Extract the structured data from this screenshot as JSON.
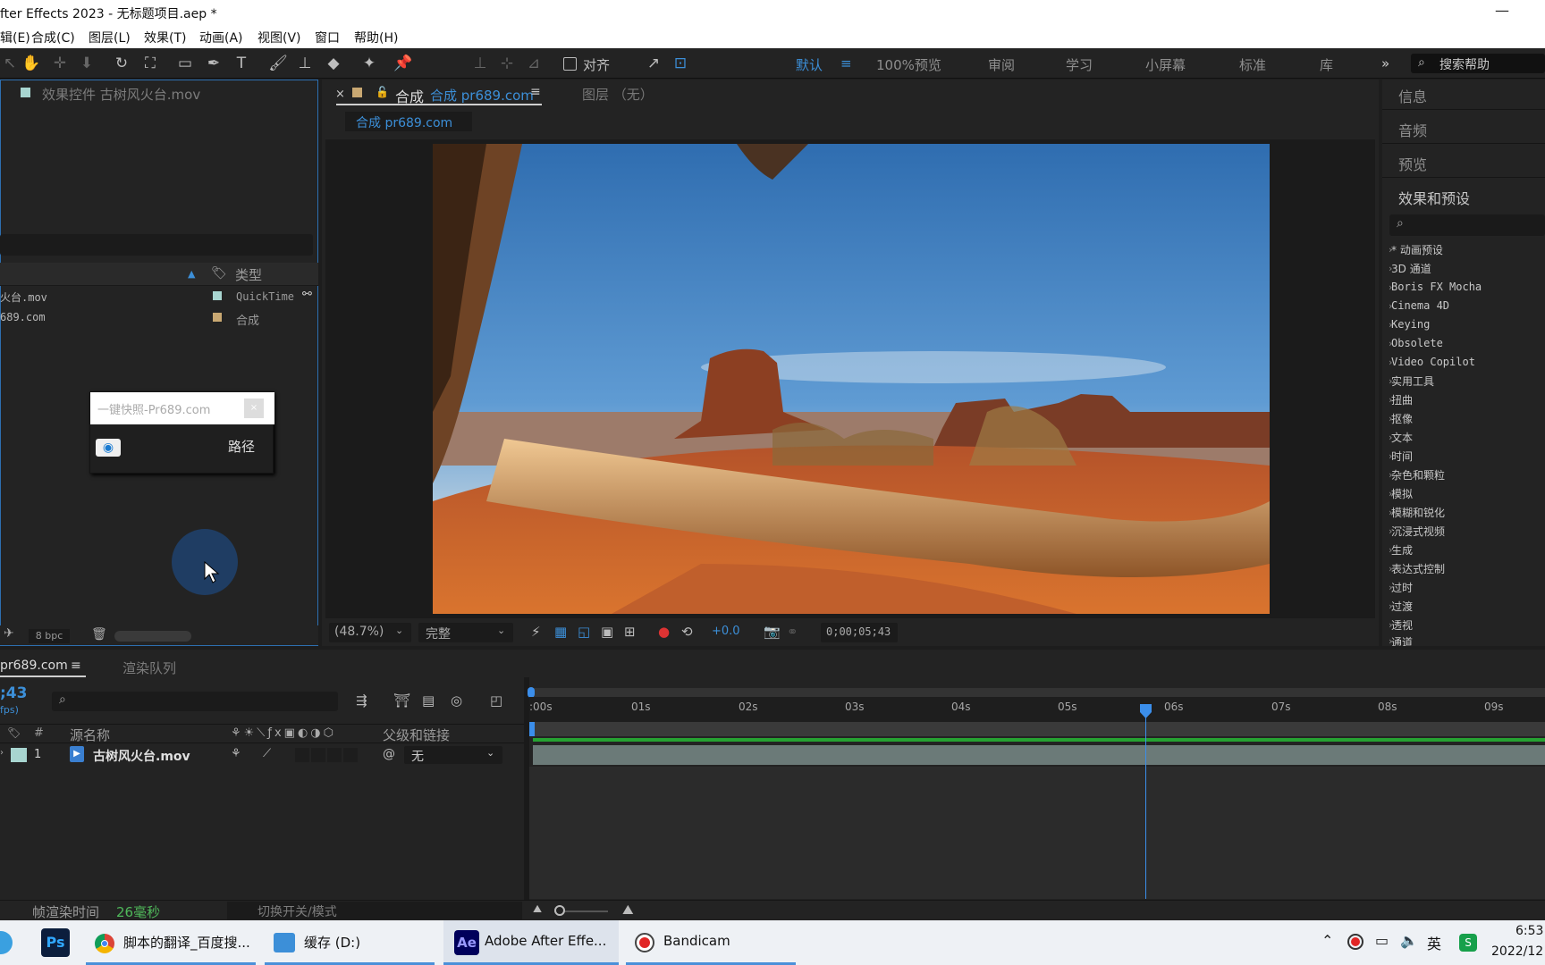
{
  "titlebar": {
    "title": "fter Effects 2023 - 无标题项目.aep *",
    "minimize": "—"
  },
  "menu": [
    "辑(E)",
    "合成(C)",
    "图层(L)",
    "效果(T)",
    "动画(A)",
    "视图(V)",
    "窗口",
    "帮助(H)"
  ],
  "toolbar": {
    "align_label": "对齐",
    "workspaces": [
      "默认",
      "100%预览",
      "审阅",
      "学习",
      "小屏幕",
      "标准",
      "库"
    ],
    "overflow": "»",
    "search_placeholder": "搜索帮助"
  },
  "left_panel": {
    "title": "效果控件 古树风火台.mov",
    "type_header": "类型",
    "rows": [
      {
        "name": "火台.mov",
        "type": "QuickTime",
        "color": "#a8d5d0"
      },
      {
        "name": "689.com",
        "type": "合成",
        "color": "#c9a872"
      }
    ],
    "bpc": "8 bpc",
    "popup": {
      "placeholder": "一键快照-Pr689.com",
      "path_label": "路径"
    }
  },
  "viewer": {
    "tab_label": "合成",
    "tab_name": "合成 pr689.com",
    "layer_tab": "图层 （无）",
    "comp_chip": "合成 pr689.com",
    "zoom": "(48.7%)",
    "quality": "完整",
    "exposure": "+0.0",
    "timecode": "0;00;05;43"
  },
  "right_panel": {
    "sections": [
      "信息",
      "音频",
      "预览",
      "效果和预设"
    ],
    "effects": [
      "* 动画预设",
      "3D 通道",
      "Boris FX Mocha",
      "Cinema 4D",
      "Keying",
      "Obsolete",
      "Video Copilot",
      "实用工具",
      "扭曲",
      "抠像",
      "文本",
      "时间",
      "杂色和颗粒",
      "模拟",
      "模糊和锐化",
      "沉浸式视频",
      "生成",
      "表达式控制",
      "过时",
      "过渡",
      "透视",
      "通道"
    ]
  },
  "timeline": {
    "tab_name": "pr689.com",
    "render_queue": "渲染队列",
    "timecode": ";43",
    "fps": "fps)",
    "col_hash": "#",
    "col_source": "源名称",
    "col_parent": "父级和链接",
    "layer_num": "1",
    "layer_name": "古树风火台.mov",
    "parent_value": "无",
    "ticks": [
      ":00s",
      "01s",
      "02s",
      "03s",
      "04s",
      "05s",
      "06s",
      "07s",
      "08s",
      "09s"
    ],
    "render_time_label": "帧渲染时间",
    "render_time_value": "26毫秒",
    "switch_mode": "切换开关/模式"
  },
  "taskbar": {
    "items": [
      {
        "label": "脚本的翻译_百度搜...",
        "icon": "chrome-icon"
      },
      {
        "label": "缓存 (D:)",
        "icon": "folder-icon"
      },
      {
        "label": "Adobe After Effe...",
        "icon": "ae-icon"
      },
      {
        "label": "Bandicam",
        "icon": "record-icon"
      }
    ],
    "ps_label": "Ps",
    "ae_label": "Ae",
    "ime": "英",
    "time": "6:53",
    "date": "2022/12"
  },
  "colors": {
    "accent": "#3c8fd8",
    "playhead": "#3b8eea",
    "green_bar": "#26a232",
    "track": "#6b7a78"
  }
}
